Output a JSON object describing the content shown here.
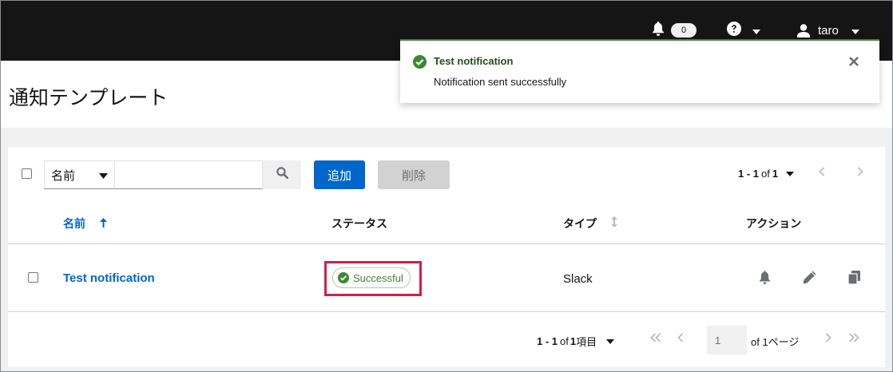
{
  "masthead": {
    "notification_count": "0",
    "user_name": "taro"
  },
  "page": {
    "title": "通知テンプレート"
  },
  "toolbar": {
    "filter_select_value": "名前",
    "search_placeholder": "",
    "add_label": "追加",
    "delete_label": "削除",
    "pagination_range": "1 - 1",
    "pagination_of": "of",
    "pagination_total": "1"
  },
  "table": {
    "columns": [
      "名前",
      "ステータス",
      "タイプ",
      "アクション"
    ],
    "rows": [
      {
        "name": "Test notification",
        "status": "Successful",
        "type": "Slack"
      }
    ]
  },
  "pagination": {
    "range": "1 - 1",
    "of": "of",
    "total": "1",
    "unit": "項目",
    "page_value": "1",
    "of_pages": "of 1ページ"
  },
  "toast": {
    "title": "Test notification",
    "description": "Notification sent successfully"
  },
  "colors": {
    "accent": "#0066cc",
    "success": "#3e8635",
    "highlight": "#d11f45",
    "masthead": "#151515"
  },
  "icons": [
    "bell-icon",
    "help-icon",
    "user-icon",
    "caret-down-icon",
    "search-icon",
    "sort-up-icon",
    "sort-icon",
    "check-circle-icon",
    "pencil-icon",
    "copy-icon",
    "close-icon",
    "angle-left-icon",
    "angle-right-icon",
    "angle-double-left-icon",
    "angle-double-right-icon"
  ]
}
